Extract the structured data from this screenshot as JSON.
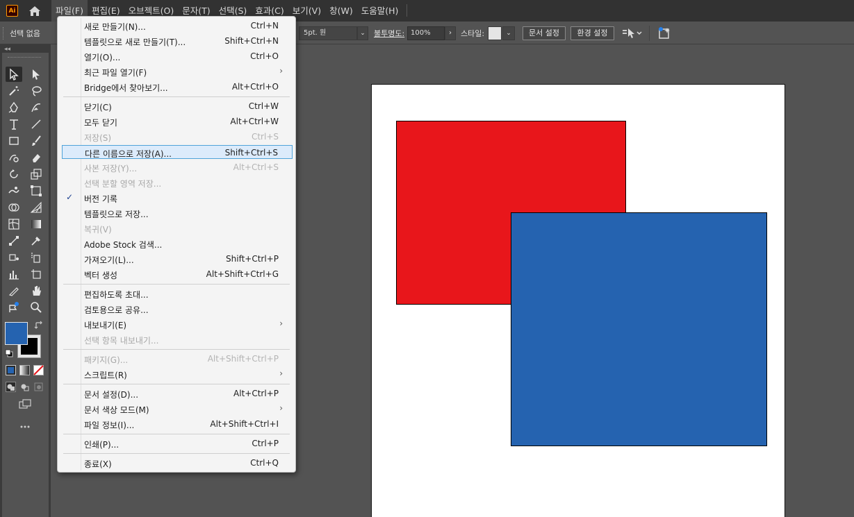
{
  "app": {
    "logo_text": "Ai",
    "menus": [
      "파일(F)",
      "편집(E)",
      "오브젝트(O)",
      "문자(T)",
      "선택(S)",
      "효과(C)",
      "보기(V)",
      "창(W)",
      "도움말(H)"
    ]
  },
  "controlbar": {
    "selection": "선택 없음",
    "stroke_size": "5pt. 원",
    "opacity_label": "불투명도:",
    "opacity_value": "100%",
    "style_label": "스타일:",
    "doc_setup": "문서 설정",
    "preferences": "환경 설정"
  },
  "colors": {
    "fill": "#2563b0",
    "red_shape": "#e8161b",
    "blue_shape": "#2563b0",
    "highlight_border": "#4fa3d9"
  },
  "file_menu": {
    "items": [
      {
        "label": "새로 만들기(N)...",
        "shortcut": "Ctrl+N"
      },
      {
        "label": "템플릿으로 새로 만들기(T)...",
        "shortcut": "Shift+Ctrl+N"
      },
      {
        "label": "열기(O)...",
        "shortcut": "Ctrl+O"
      },
      {
        "label": "최근 파일 열기(F)",
        "shortcut": ""
      },
      {
        "label": "Bridge에서 찾아보기...",
        "shortcut": "Alt+Ctrl+O"
      },
      {
        "label": "닫기(C)",
        "shortcut": "Ctrl+W"
      },
      {
        "label": "모두 닫기",
        "shortcut": "Alt+Ctrl+W"
      },
      {
        "label": "저장(S)",
        "shortcut": "Ctrl+S"
      },
      {
        "label": "다른 이름으로 저장(A)...",
        "shortcut": "Shift+Ctrl+S"
      },
      {
        "label": "사본 저장(Y)...",
        "shortcut": "Alt+Ctrl+S"
      },
      {
        "label": "선택 분할 영역 저장...",
        "shortcut": ""
      },
      {
        "label": "버전 기록",
        "shortcut": "",
        "check": "✓"
      },
      {
        "label": "템플릿으로 저장...",
        "shortcut": ""
      },
      {
        "label": "복귀(V)",
        "shortcut": ""
      },
      {
        "label": "Adobe Stock 검색...",
        "shortcut": ""
      },
      {
        "label": "가져오기(L)...",
        "shortcut": "Shift+Ctrl+P"
      },
      {
        "label": "벡터 생성",
        "shortcut": "Alt+Shift+Ctrl+G"
      },
      {
        "label": "편집하도록 초대...",
        "shortcut": ""
      },
      {
        "label": "검토용으로 공유...",
        "shortcut": ""
      },
      {
        "label": "내보내기(E)",
        "shortcut": ""
      },
      {
        "label": "선택 항목 내보내기...",
        "shortcut": ""
      },
      {
        "label": "패키지(G)...",
        "shortcut": "Alt+Shift+Ctrl+P"
      },
      {
        "label": "스크립트(R)",
        "shortcut": ""
      },
      {
        "label": "문서 설정(D)...",
        "shortcut": "Alt+Ctrl+P"
      },
      {
        "label": "문서 색상 모드(M)",
        "shortcut": ""
      },
      {
        "label": "파일 정보(I)...",
        "shortcut": "Alt+Shift+Ctrl+I"
      },
      {
        "label": "인쇄(P)...",
        "shortcut": "Ctrl+P"
      },
      {
        "label": "종료(X)",
        "shortcut": "Ctrl+Q"
      }
    ]
  }
}
